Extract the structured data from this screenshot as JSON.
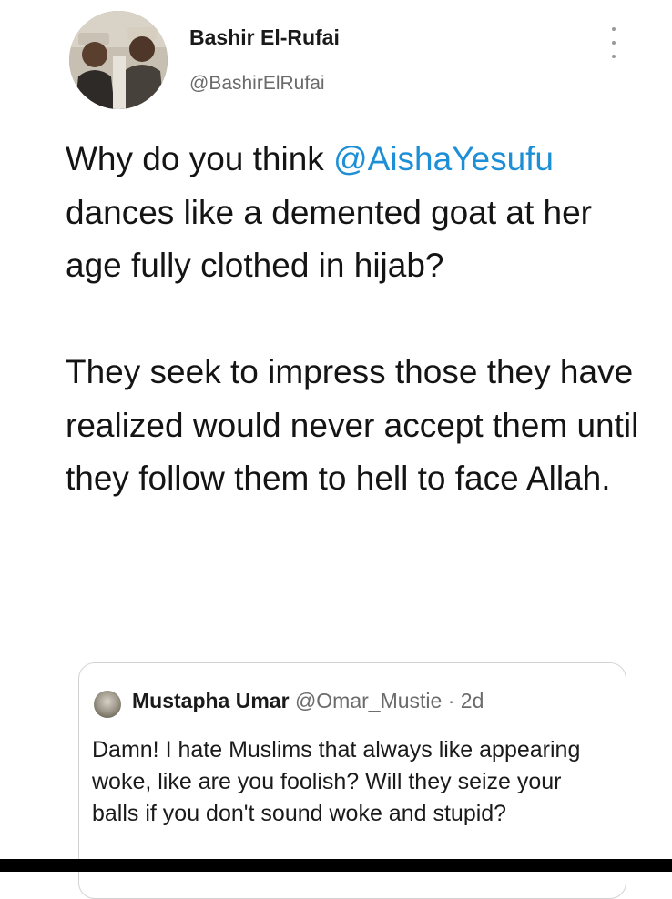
{
  "tweet": {
    "author_name": "Bashir El-Rufai",
    "author_handle": "@BashirElRufai",
    "text_part1": "Why do you think ",
    "mention": "@AishaYesufu",
    "text_part2": " dances like a demented goat at her age fully clothed in hijab?",
    "text_paragraph2": "They seek to impress those they have realized would never accept them until they follow them to hell to face Allah."
  },
  "quoted_tweet": {
    "author_name": "Mustapha Umar",
    "author_handle": "@Omar_Mustie",
    "separator": " · ",
    "time": "2d",
    "text": "Damn! I hate Muslims that always like appearing woke, like are you foolish? Will they seize your balls if you don't sound woke and stupid?"
  },
  "icons": {
    "more": "more-vertical-icon"
  },
  "colors": {
    "mention": "#1d8fd6",
    "handle": "#6b6b6b",
    "text": "#141414",
    "quote_border": "#d3d3d3"
  }
}
